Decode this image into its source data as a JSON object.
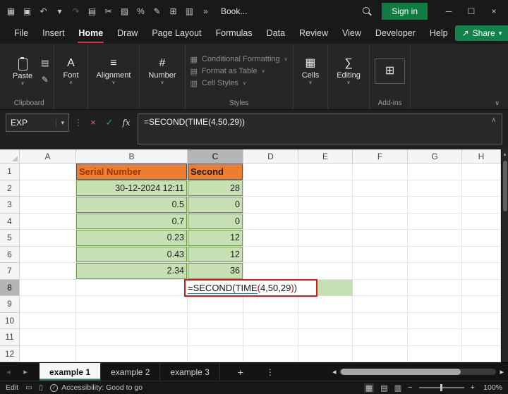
{
  "titlebar": {
    "title": "Book...",
    "sign_in_label": "Sign in",
    "quick_icons": [
      {
        "name": "ribbon-display-icon",
        "glyph": "▦"
      },
      {
        "name": "save-icon",
        "glyph": "▣"
      },
      {
        "name": "undo-icon",
        "glyph": "↶"
      },
      {
        "name": "undo-dropdown-icon",
        "glyph": "▾"
      },
      {
        "name": "redo-icon",
        "glyph": "↷",
        "dim": true
      },
      {
        "name": "copy-book-icon",
        "glyph": "▤"
      },
      {
        "name": "cut-icon",
        "glyph": "✂"
      },
      {
        "name": "picture-icon",
        "glyph": "▨"
      },
      {
        "name": "percent-icon",
        "glyph": "%"
      },
      {
        "name": "draw-icon",
        "glyph": "✎"
      },
      {
        "name": "borders-icon",
        "glyph": "⊞"
      },
      {
        "name": "chart-icon",
        "glyph": "▥"
      },
      {
        "name": "toolbar-overflow-icon",
        "glyph": "»"
      }
    ]
  },
  "menu": {
    "items": [
      "File",
      "Insert",
      "Home",
      "Draw",
      "Page Layout",
      "Formulas",
      "Data",
      "Review",
      "View",
      "Developer",
      "Help"
    ],
    "active_index": 2,
    "share_label": "Share"
  },
  "ribbon": {
    "paste_label": "Paste",
    "clipboard_group_label": "Clipboard",
    "big_buttons": [
      {
        "name": "font",
        "label": "Font",
        "glyph": "A"
      },
      {
        "name": "alignment",
        "label": "Alignment",
        "glyph": "≡"
      },
      {
        "name": "number",
        "label": "Number",
        "glyph": "#"
      }
    ],
    "styles_items": [
      {
        "label": "Conditional Formatting",
        "glyph": "▦"
      },
      {
        "label": "Format as Table",
        "glyph": "▤"
      },
      {
        "label": "Cell Styles",
        "glyph": "▥"
      }
    ],
    "styles_group_label": "Styles",
    "right_buttons": [
      {
        "name": "cells",
        "label": "Cells",
        "glyph": "▦"
      },
      {
        "name": "editing",
        "label": "Editing",
        "glyph": "∑"
      }
    ],
    "addins_group_label": "Add-ins"
  },
  "formula_bar": {
    "name_box": "EXP",
    "fx": "fx",
    "formula": "=SECOND(TIME(4,50,29))"
  },
  "grid": {
    "column_headers": [
      "A",
      "B",
      "C",
      "D",
      "E",
      "F",
      "G",
      "H"
    ],
    "row_count": 12,
    "selected_column": "C",
    "selected_row": 8,
    "table": {
      "header_serial": "Serial Number",
      "header_second": "Second",
      "rows": [
        [
          "30-12-2024 12:11",
          "28"
        ],
        [
          "0.5",
          "0"
        ],
        [
          "0.7",
          "0"
        ],
        [
          "0.23",
          "12"
        ],
        [
          "0.43",
          "12"
        ],
        [
          "2.34",
          "36"
        ]
      ]
    },
    "editing_cell": {
      "ref": "C8",
      "pre": "=SECOND(TIME",
      "lparen": "(",
      "args": "4,50,29",
      "rparen": ")",
      "close": ")"
    }
  },
  "sheet_tabs": {
    "tabs": [
      "example 1",
      "example 2",
      "example 3"
    ],
    "active_index": 0,
    "add_label": "+"
  },
  "status_bar": {
    "mode": "Edit",
    "accessibility": "Accessibility: Good to go",
    "zoom": "100%"
  },
  "icons": {
    "minimize": "─",
    "maximize": "☐",
    "close": "×",
    "cancel": "×",
    "enter": "✓",
    "name_box_dropdown": "▾",
    "separator_dots": "⋮",
    "collapse_up": "∧",
    "ribbon_collapse": "∨",
    "share_arrow": "↗",
    "share_dropdown": "▾",
    "addins_glyph": "⊞",
    "clipboard_small_1": "▤",
    "clipboard_small_2": "✎",
    "sheet_nav_left": "◂",
    "sheet_nav_right": "▸",
    "more_dots": "⋮",
    "scroll_left": "◂",
    "scroll_right": "▸",
    "scroll_up": "▴",
    "view_normal": "▦",
    "view_page_layout": "▤",
    "view_page_break": "▥",
    "zoom_out": "−",
    "zoom_in": "+",
    "status_left_1": "▭",
    "status_left_2": "▯",
    "accessibility_check": "✓"
  },
  "colors": {
    "accent_green": "#107C41",
    "header_orange": "#ED7D31",
    "cell_green": "#C6E0B4",
    "table_border_green": "#548235",
    "edit_border_red": "#E01515",
    "active_menu_underline": "#D13438"
  }
}
